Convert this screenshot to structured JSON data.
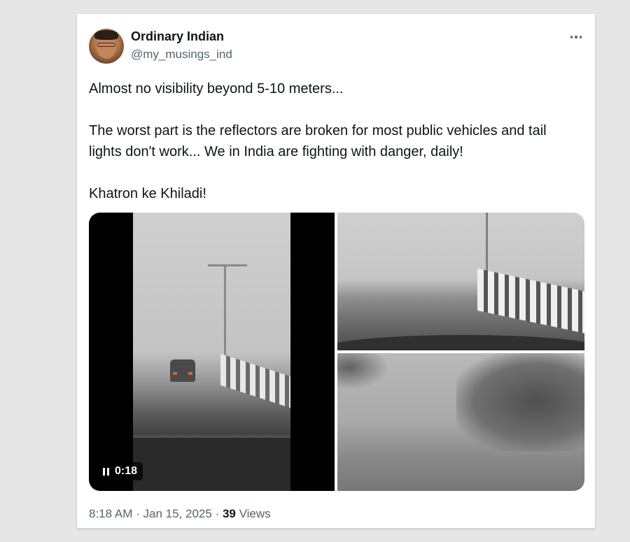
{
  "author": {
    "name": "Ordinary Indian",
    "handle": "@my_musings_ind"
  },
  "post": {
    "line1": "Almost no visibility beyond 5-10 meters...",
    "line2": "The worst part is the reflectors are broken for most public vehicles and tail lights don't work... We in India are fighting with danger, daily!",
    "line3": "Khatron ke Khiladi!"
  },
  "media": {
    "video_time": "0:18",
    "video_state": "playing",
    "icons": [
      "pause-icon",
      "more-options-icon"
    ]
  },
  "meta": {
    "time": "8:18 AM",
    "separator": "·",
    "date": "Jan 15, 2025",
    "views_count": "39",
    "views_label": "Views"
  }
}
